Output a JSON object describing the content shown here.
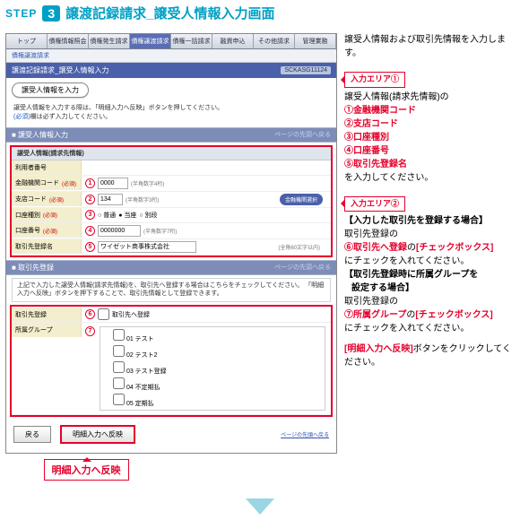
{
  "step": {
    "label": "STEP",
    "num": "3",
    "title": "譲渡記録請求_譲受人情報入力画面"
  },
  "tabs": [
    "トップ",
    "債権情報照会",
    "債権発生請求",
    "債権譲渡請求",
    "債権一括請求",
    "融資申込",
    "その他請求",
    "管理業務"
  ],
  "activeTab": 3,
  "subbar": "債権譲渡請求",
  "pane": {
    "title": "譲渡記録請求_譲受人情報入力",
    "code": "SCKASG11124"
  },
  "roundBtn": "譲受人情報を入力",
  "desc": {
    "l1": "譲受人情報を入力する際は、「明細入力へ反映」ボタンを押してください。",
    "l2": "(必須)",
    "l3": "欄は必ず入力してください。"
  },
  "sect1": {
    "title": "■ 譲受人情報入力",
    "page": "ページの先頭へ戻る"
  },
  "form1": {
    "header": "譲受人情報(請求先情報)",
    "r0": {
      "k": "利用者番号",
      "v": ""
    },
    "r1": {
      "k": "金融機関コード",
      "req": "(必須)",
      "v": "0000",
      "hint": "(半角数字4桁)"
    },
    "r2": {
      "k": "支店コード",
      "req": "(必須)",
      "v": "134",
      "hint": "(半角数字3桁)",
      "btn": "金融機関選択"
    },
    "r3": {
      "k": "口座種別",
      "req": "(必須)",
      "o1": "普通",
      "o2": "当座",
      "o3": "別段"
    },
    "r4": {
      "k": "口座番号",
      "req": "(必須)",
      "v": "0000000",
      "hint": "(半角数字7桁)"
    },
    "r5": {
      "k": "取引先登録名",
      "v": "ワイゼット商事株式会社",
      "note": "(全角60文字以内)"
    }
  },
  "sect2": {
    "title": "■ 取引先登録"
  },
  "txbox": "上記で入力した譲受人情報(請求先情報)を、取引先へ登録する場合はこちらをチェックしてください。\n「明細入力へ反映」ボタンを押下することで、取引先情報として登録できます。",
  "form2": {
    "r6": {
      "k": "取引先登録",
      "lbl": "取引先へ登録"
    },
    "r7": {
      "k": "所属グループ",
      "items": [
        "01 テスト",
        "02 テスト2",
        "03 テスト登録",
        "04 不定期払",
        "05 定期払"
      ]
    }
  },
  "btm": {
    "back": "戻る",
    "reflect": "明細入力へ反映",
    "toplink": "ページの先頭へ戻る"
  },
  "callout": "明細入力へ反映",
  "right": {
    "intro": "譲受人情報および取引先情報を入力します。",
    "area1": "入力エリア①",
    "a1_lead": "譲受人情報(請求先情報)の",
    "a1_items": [
      "①金融機関コード",
      "②支店コード",
      "③口座種別",
      "④口座番号",
      "⑤取引先登録名"
    ],
    "a1_tail": "を入力してください。",
    "area2": "入力エリア②",
    "b_h1": "【入力した取引先を登録する場合】",
    "b_l1": "取引先登録の",
    "b_l2a": "⑥取引先へ登録",
    "b_l2b": "の",
    "b_l2c": "[チェックボックス]",
    "b_l3": "にチェックを入れてください。",
    "b_h2a": "【取引先登録時に所属グループを",
    "b_h2b": "設定する場合】",
    "b_l4": "取引先登録の",
    "b_l5a": "⑦所属グループ",
    "b_l5b": "の",
    "b_l5c": "[チェックボックス]",
    "b_l6": "にチェックを入れてください。",
    "c1": "[明細入力へ反映]",
    "c2": "ボタンをクリックしてください。"
  }
}
